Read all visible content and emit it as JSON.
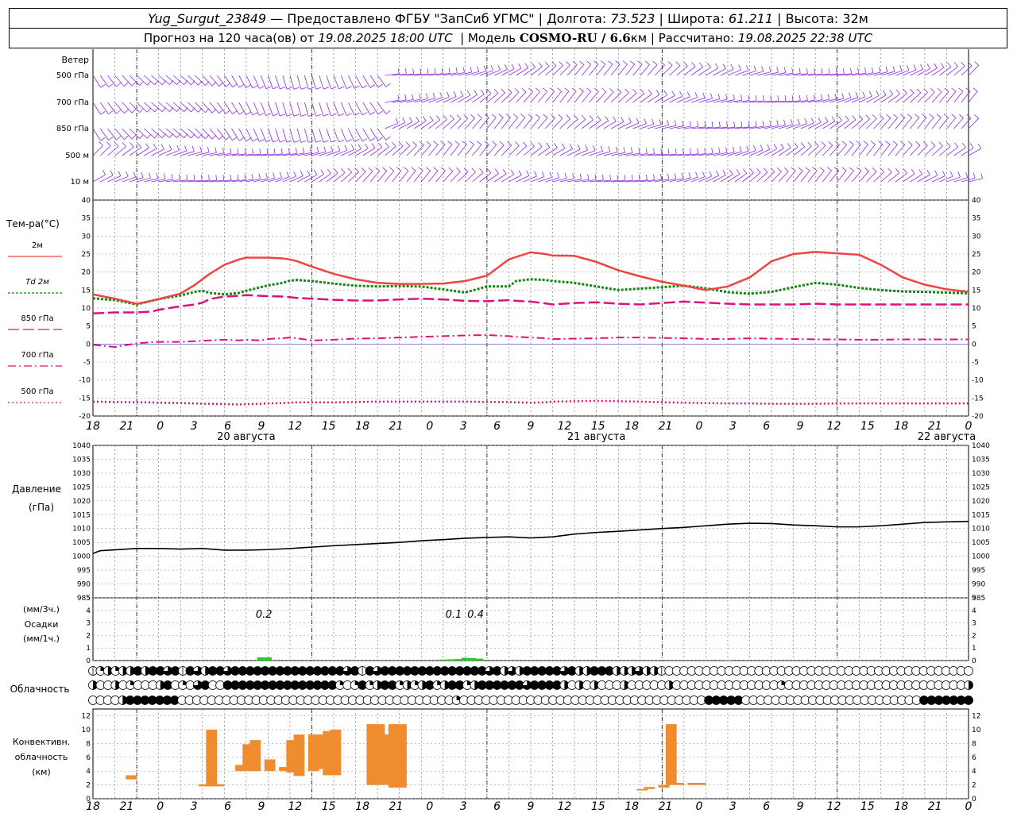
{
  "header": {
    "station": "Yug_Surgut_23849",
    "provider": "— Предоставлено ФГБУ \"ЗапСиб УГМС\" | Долгота:",
    "lon": "73.523",
    "lat_label": "| Широта:",
    "lat": "61.211",
    "alt_label": "| Высота:",
    "alt": "32м",
    "forecast_label": "Прогноз на 120 часа(ов) от",
    "forecast_time": "19.08.2025 18:00 UTC",
    "model_label": "| Модель",
    "model": "COSMO-RU / 6.6",
    "model_unit": "км",
    "calc_label": "| Рассчитано:",
    "calc_time": "19.08.2025 22:38 UTC"
  },
  "labels": {
    "wind": "Ветер",
    "wind_levels": [
      "500 гПа",
      "700 гПа",
      "850 гПа",
      "500 м",
      "10  м"
    ],
    "temp_title": "Тем-ра(°С)",
    "legend": [
      "2м",
      "Td  2м",
      "850 гПа",
      "700 гПа",
      "500 гПа"
    ],
    "pressure": [
      "Давление",
      "(гПа)"
    ],
    "precip": [
      "(мм/3ч.)",
      "Осадки",
      "(мм/1ч.)"
    ],
    "cloud": "Облачность",
    "convective": [
      "Конвективн.",
      "облачность",
      "(км)"
    ]
  },
  "colors": {
    "wind": "#8a2be2",
    "t2m": "#ee4444",
    "td2m": "#118811",
    "t850": "#e0107a",
    "t700": "#e0107a",
    "t500": "#e0107a",
    "pressure": "#000000",
    "precip": "#22cc22",
    "convective": "#f08c30"
  },
  "chart_data": {
    "type": "line",
    "hour_ticks": [
      "18",
      "21",
      "0",
      "3",
      "6",
      "9",
      "12",
      "15",
      "18",
      "21",
      "0",
      "3",
      "6",
      "9",
      "12",
      "15",
      "18",
      "21",
      "0",
      "3",
      "6",
      "9",
      "12",
      "15",
      "18",
      "21",
      "0"
    ],
    "day_labels": [
      "20 августа",
      "21 августа",
      "22 августа"
    ],
    "temperature": {
      "ylim": [
        -20,
        40
      ],
      "yticks": [
        40,
        35,
        30,
        25,
        20,
        15,
        10,
        5,
        0,
        -5,
        -10,
        -15,
        -20
      ],
      "hours": [
        0,
        3,
        6,
        8,
        9,
        12,
        14,
        15,
        16,
        18,
        20,
        21,
        23,
        24,
        26,
        27,
        28,
        30,
        33,
        36,
        39,
        42,
        45,
        48,
        51,
        54,
        57,
        58,
        60,
        62,
        63,
        66,
        69,
        72,
        75,
        78,
        81,
        84,
        87,
        90,
        93,
        96,
        99,
        102,
        105,
        108,
        111,
        114,
        117,
        120
      ],
      "t2m": [
        13.8,
        12.6,
        11.2,
        12.0,
        12.5,
        14.0,
        16.5,
        18.0,
        19.5,
        22.0,
        23.5,
        24.0,
        24.0,
        24.0,
        23.8,
        23.5,
        23.0,
        21.5,
        19.5,
        18.0,
        17.0,
        16.7,
        16.7,
        16.8,
        17.5,
        19.0,
        23.5,
        24.2,
        25.5,
        25.0,
        24.6,
        24.5,
        22.8,
        20.5,
        18.8,
        17.3,
        16.2,
        15.0,
        16.0,
        18.5,
        23.0,
        25.0,
        25.6,
        25.2,
        24.8,
        22.0,
        18.5,
        16.5,
        15.2,
        14.5
      ],
      "td2m": [
        12.7,
        12.2,
        11.0,
        12.0,
        12.5,
        13.5,
        14.5,
        14.8,
        14.2,
        13.8,
        14.2,
        14.8,
        15.8,
        16.3,
        17.0,
        17.6,
        17.8,
        17.5,
        16.8,
        16.2,
        16.0,
        16.1,
        16.0,
        15.2,
        14.3,
        16.0,
        16.0,
        17.5,
        18.0,
        17.8,
        17.5,
        17.0,
        16.0,
        15.0,
        15.4,
        15.8,
        16.2,
        15.5,
        14.4,
        14.0,
        14.5,
        15.8,
        17.0,
        16.5,
        15.6,
        15.0,
        14.6,
        14.5,
        14.3,
        14.1
      ],
      "t850": [
        8.5,
        8.8,
        8.8,
        9.0,
        9.5,
        10.5,
        11.0,
        11.5,
        12.5,
        13.2,
        13.4,
        13.6,
        13.4,
        13.3,
        13.2,
        13.0,
        12.8,
        12.6,
        12.3,
        12.1,
        12.1,
        12.4,
        12.6,
        12.4,
        12.0,
        11.9,
        12.2,
        12.0,
        11.8,
        11.3,
        11.0,
        11.4,
        11.6,
        11.2,
        11.0,
        11.4,
        11.8,
        11.5,
        11.2,
        11.0,
        11.0,
        11.0,
        11.2,
        11.0,
        11.0,
        11.0,
        11.0,
        11.0,
        11.0,
        11.0
      ],
      "t700": [
        -0.2,
        -0.8,
        0.2,
        0.5,
        0.6,
        0.6,
        0.8,
        0.9,
        1.0,
        1.2,
        1.0,
        1.2,
        1.0,
        1.4,
        1.6,
        1.8,
        1.6,
        1.0,
        1.2,
        1.5,
        1.6,
        1.8,
        2.0,
        2.2,
        2.4,
        2.5,
        2.2,
        2.0,
        1.8,
        1.6,
        1.4,
        1.5,
        1.6,
        1.8,
        1.8,
        1.7,
        1.6,
        1.4,
        1.4,
        1.6,
        1.5,
        1.4,
        1.3,
        1.3,
        1.2,
        1.2,
        1.3,
        1.3,
        1.3,
        1.3
      ],
      "t500": [
        -16.0,
        -16.1,
        -16.2,
        -16.2,
        -16.3,
        -16.4,
        -16.5,
        -16.6,
        -16.6,
        -16.7,
        -16.8,
        -16.7,
        -16.6,
        -16.5,
        -16.4,
        -16.3,
        -16.2,
        -16.2,
        -16.2,
        -16.1,
        -16.0,
        -16.0,
        -16.0,
        -16.0,
        -16.0,
        -16.1,
        -16.1,
        -16.2,
        -16.3,
        -16.2,
        -16.0,
        -15.9,
        -15.8,
        -15.9,
        -16.0,
        -16.2,
        -16.3,
        -16.4,
        -16.5,
        -16.5,
        -16.6,
        -16.6,
        -16.6,
        -16.5,
        -16.5,
        -16.5,
        -16.5,
        -16.5,
        -16.5,
        -16.5
      ]
    },
    "pressure": {
      "ylim": [
        985,
        1040
      ],
      "yticks": [
        1040,
        1035,
        1030,
        1025,
        1020,
        1015,
        1010,
        1005,
        1000,
        995,
        990,
        985
      ],
      "hours": [
        0,
        1,
        3,
        6,
        9,
        12,
        15,
        18,
        21,
        24,
        27,
        30,
        33,
        36,
        39,
        42,
        45,
        48,
        51,
        54,
        57,
        60,
        63,
        66,
        69,
        72,
        75,
        78,
        81,
        84,
        87,
        90,
        93,
        96,
        99,
        102,
        105,
        108,
        111,
        114,
        117,
        120
      ],
      "values": [
        1001.0,
        1002.0,
        1002.3,
        1002.8,
        1002.8,
        1002.6,
        1002.8,
        1002.2,
        1002.2,
        1002.4,
        1002.8,
        1003.3,
        1003.8,
        1004.2,
        1004.6,
        1005.0,
        1005.6,
        1006.0,
        1006.5,
        1006.8,
        1007.0,
        1006.6,
        1007.0,
        1008.0,
        1008.6,
        1009.0,
        1009.5,
        1010.0,
        1010.4,
        1011.0,
        1011.6,
        1011.9,
        1011.8,
        1011.3,
        1011.0,
        1010.6,
        1010.6,
        1011.0,
        1011.6,
        1012.2,
        1012.4,
        1012.6
      ],
      "extra": [
        1012.2,
        1012.8
      ]
    },
    "precip": {
      "ylim": [
        0,
        5
      ],
      "yticks": [
        5,
        4,
        3,
        2,
        1,
        0
      ],
      "bars_1h": [
        {
          "h": 23,
          "v": 0.25
        },
        {
          "h": 24,
          "v": 0.25
        },
        {
          "h": 48,
          "v": 0.08
        },
        {
          "h": 49,
          "v": 0.1
        },
        {
          "h": 50,
          "v": 0.12
        },
        {
          "h": 51,
          "v": 0.22
        },
        {
          "h": 52,
          "v": 0.2
        },
        {
          "h": 53,
          "v": 0.15
        },
        {
          "h": 87,
          "v": 0.03
        }
      ],
      "labels_3h": [
        {
          "h": 23,
          "text": "0.2"
        },
        {
          "h": 49,
          "text": "0.1"
        },
        {
          "h": 52,
          "text": "0.4"
        }
      ]
    },
    "cloud": {
      "rows": [
        "cqhqhhxhxxtxcxthxxtxxxxxxxxxxxxxxxtxcxtxxxxxxxxxxxxxxtxhthxxxxxtxhhxxxhhhthhcooooooooooooooooooooooooooooooooooooooooo",
        "hoohoqooohxoqotxooxxxxxxxxxxxxxxxqoqxqhxxqhqhxqhxxqhxxxxxxtxxxxhohohooohooooohooooooooooooooqooooooooooooooooooooooooh",
        "oooohxxxxxxxoooooooooooooooooooooooooooooooooooooqoooooooooooooooooooooooooooooooooxxxxxooooooooooooooooooooooooxxxxxxx"
      ]
    },
    "convective": {
      "ylim": [
        0,
        13
      ],
      "yticks": [
        12,
        10,
        8,
        6,
        4,
        2,
        0
      ],
      "bars": [
        {
          "h": 5,
          "b": 2.8,
          "t": 3.4
        },
        {
          "h": 15,
          "b": 1.8,
          "t": 2.1
        },
        {
          "h": 16,
          "b": 1.8,
          "t": 10.0
        },
        {
          "h": 17,
          "b": 1.8,
          "t": 2.1
        },
        {
          "h": 20,
          "b": 4.0,
          "t": 4.9
        },
        {
          "h": 21,
          "b": 4.0,
          "t": 7.9
        },
        {
          "h": 22,
          "b": 4.0,
          "t": 8.5
        },
        {
          "h": 24,
          "b": 4.0,
          "t": 5.7
        },
        {
          "h": 26,
          "b": 4.0,
          "t": 4.6
        },
        {
          "h": 27,
          "b": 3.8,
          "t": 8.5
        },
        {
          "h": 28,
          "b": 3.3,
          "t": 9.3
        },
        {
          "h": 30,
          "b": 4.0,
          "t": 9.3
        },
        {
          "h": 31,
          "b": 4.3,
          "t": 9.3
        },
        {
          "h": 32,
          "b": 3.4,
          "t": 9.8
        },
        {
          "h": 33,
          "b": 3.4,
          "t": 10.0
        },
        {
          "h": 38,
          "b": 2.0,
          "t": 10.8
        },
        {
          "h": 39,
          "b": 2.0,
          "t": 10.8
        },
        {
          "h": 40,
          "b": 2.0,
          "t": 9.3
        },
        {
          "h": 41,
          "b": 1.6,
          "t": 10.8
        },
        {
          "h": 42,
          "b": 1.6,
          "t": 10.8
        },
        {
          "h": 75,
          "b": 1.2,
          "t": 1.4
        },
        {
          "h": 76,
          "b": 1.4,
          "t": 1.7
        },
        {
          "h": 78,
          "b": 1.6,
          "t": 2.0
        },
        {
          "h": 79,
          "b": 2.0,
          "t": 10.8
        },
        {
          "h": 80,
          "b": 2.0,
          "t": 2.3
        },
        {
          "h": 82,
          "b": 2.0,
          "t": 2.3
        },
        {
          "h": 83,
          "b": 2.0,
          "t": 2.3
        }
      ]
    }
  }
}
